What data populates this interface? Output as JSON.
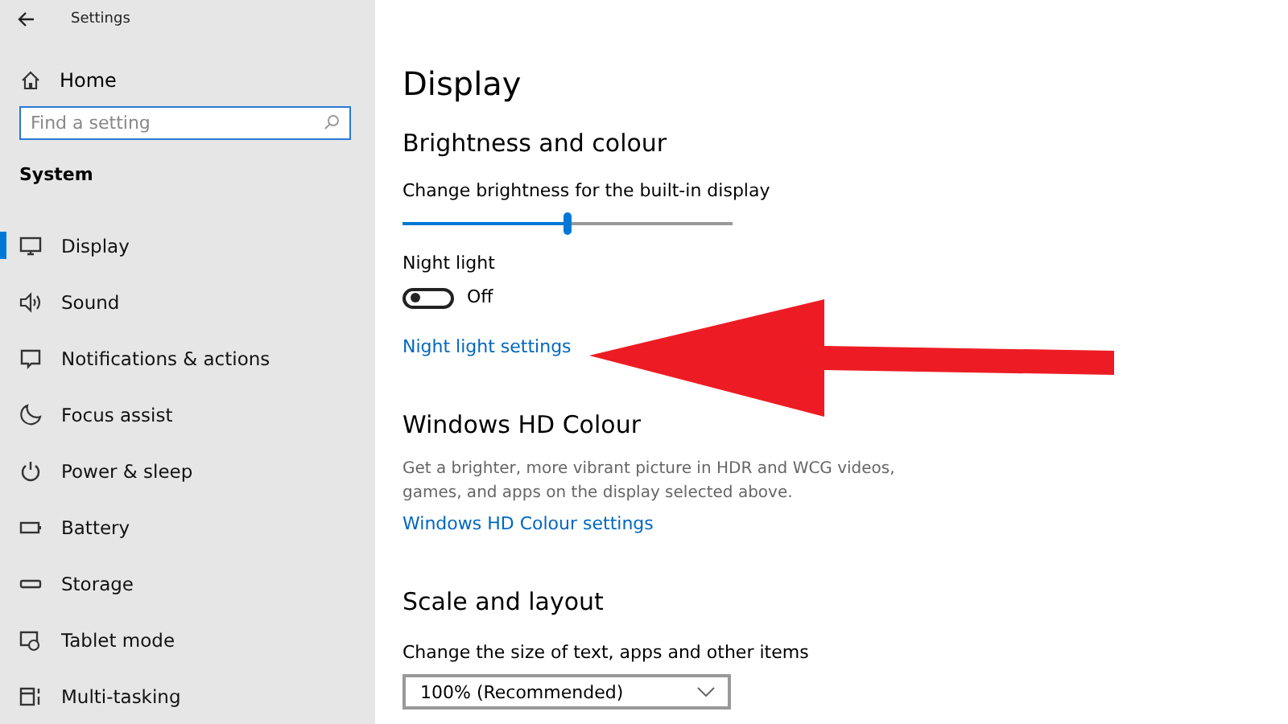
{
  "window": {
    "title": "Settings"
  },
  "sidebar": {
    "home": "Home",
    "search": {
      "placeholder": "Find a setting"
    },
    "section": "System",
    "items": [
      {
        "label": "Display",
        "selected": true
      },
      {
        "label": "Sound",
        "selected": false
      },
      {
        "label": "Notifications & actions",
        "selected": false
      },
      {
        "label": "Focus assist",
        "selected": false
      },
      {
        "label": "Power & sleep",
        "selected": false
      },
      {
        "label": "Battery",
        "selected": false
      },
      {
        "label": "Storage",
        "selected": false
      },
      {
        "label": "Tablet mode",
        "selected": false
      },
      {
        "label": "Multi-tasking",
        "selected": false
      }
    ]
  },
  "main": {
    "title": "Display",
    "brightness": {
      "heading": "Brightness and colour",
      "slider_label": "Change brightness for the built-in display",
      "level": 0.5
    },
    "night_light": {
      "label": "Night light",
      "on": false,
      "state_text": "Off",
      "link": "Night light settings"
    },
    "hd_colour": {
      "heading": "Windows HD Colour",
      "description": "Get a brighter, more vibrant picture in HDR and WCG videos, games, and apps on the display selected above.",
      "link": "Windows HD Colour settings"
    },
    "scale": {
      "heading": "Scale and layout",
      "label": "Change the size of text, apps and other items",
      "dropdown": "100% (Recommended)"
    }
  },
  "annotation": {
    "kind": "arrow"
  }
}
